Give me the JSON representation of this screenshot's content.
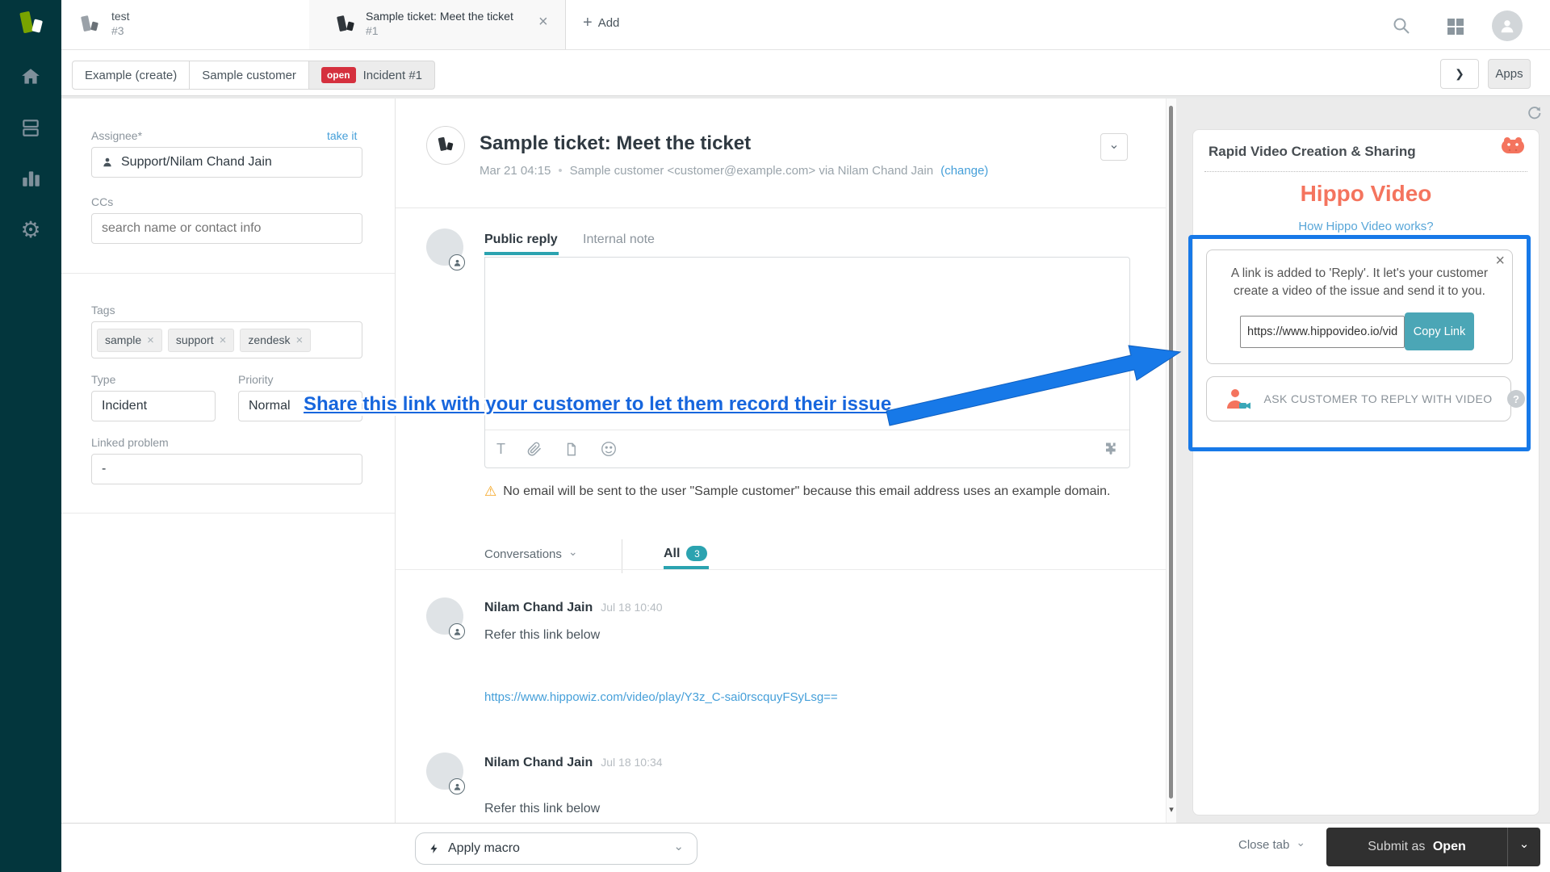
{
  "topbar": {
    "tabs": [
      {
        "title": "test",
        "subtitle": "#3"
      },
      {
        "title": "Sample ticket: Meet the ticket",
        "subtitle": "#1"
      }
    ],
    "add_label": "Add"
  },
  "breadcrumb": {
    "items": [
      "Example (create)",
      "Sample customer"
    ],
    "status_badge": "open",
    "current": "Incident #1",
    "apps_label": "Apps"
  },
  "properties": {
    "assignee_label": "Assignee*",
    "take_it": "take it",
    "assignee_value": "Support/Nilam Chand Jain",
    "ccs_label": "CCs",
    "ccs_placeholder": "search name or contact info",
    "tags_label": "Tags",
    "tags": [
      "sample",
      "support",
      "zendesk"
    ],
    "type_label": "Type",
    "type_value": "Incident",
    "priority_label": "Priority",
    "priority_value": "Normal",
    "linked_label": "Linked problem",
    "linked_value": "-"
  },
  "ticket": {
    "title": "Sample ticket: Meet the ticket",
    "date": "Mar 21 04:15",
    "requester": "Sample customer <customer@example.com> via Nilam Chand Jain",
    "change_link": "(change)",
    "reply_tab": "Public reply",
    "note_tab": "Internal note",
    "warning": "No email will be sent to the user \"Sample customer\" because this email address uses an example domain.",
    "conversations_label": "Conversations",
    "filter_label": "All",
    "filter_count": "3",
    "comments": [
      {
        "author": "Nilam Chand Jain",
        "time": "Jul 18 10:40",
        "text": "Refer this link below",
        "link": "https://www.hippowiz.com/video/play/Y3z_C-sai0rscquyFSyLsg=="
      },
      {
        "author": "Nilam Chand Jain",
        "time": "Jul 18 10:34",
        "text": "Refer this link below"
      }
    ]
  },
  "annotation": {
    "text": "Share this link with your customer to let them record their issue"
  },
  "hippo": {
    "panel_title": "Rapid Video Creation & Sharing",
    "logo_text": "Hippo Video",
    "how_link": "How Hippo Video works?",
    "notice": "A link is added to 'Reply'. It let's your customer create a video of the issue and send it to you.",
    "url_visible": "https://www.hippovideo.io/vid",
    "copy_label": "Copy Link",
    "ask_label": "ASK CUSTOMER TO REPLY WITH VIDEO"
  },
  "footer": {
    "apply_macro": "Apply macro",
    "close_tab": "Close tab",
    "submit_prefix": "Submit as",
    "submit_status": "Open"
  },
  "colors": {
    "nav_bg": "#03363d",
    "teal": "#2ba3b0",
    "copy_teal": "#4ba6b6",
    "blue": "#1779e8",
    "orange": "#f4745e",
    "open_red": "#d5303e",
    "link": "#459fd9"
  },
  "icons": {
    "close": "×",
    "chevron_down": "⌄",
    "chevron_right": "❯",
    "warning": "⚠",
    "gear": "⚙",
    "plus": "+",
    "dot": "•",
    "question": "?"
  }
}
